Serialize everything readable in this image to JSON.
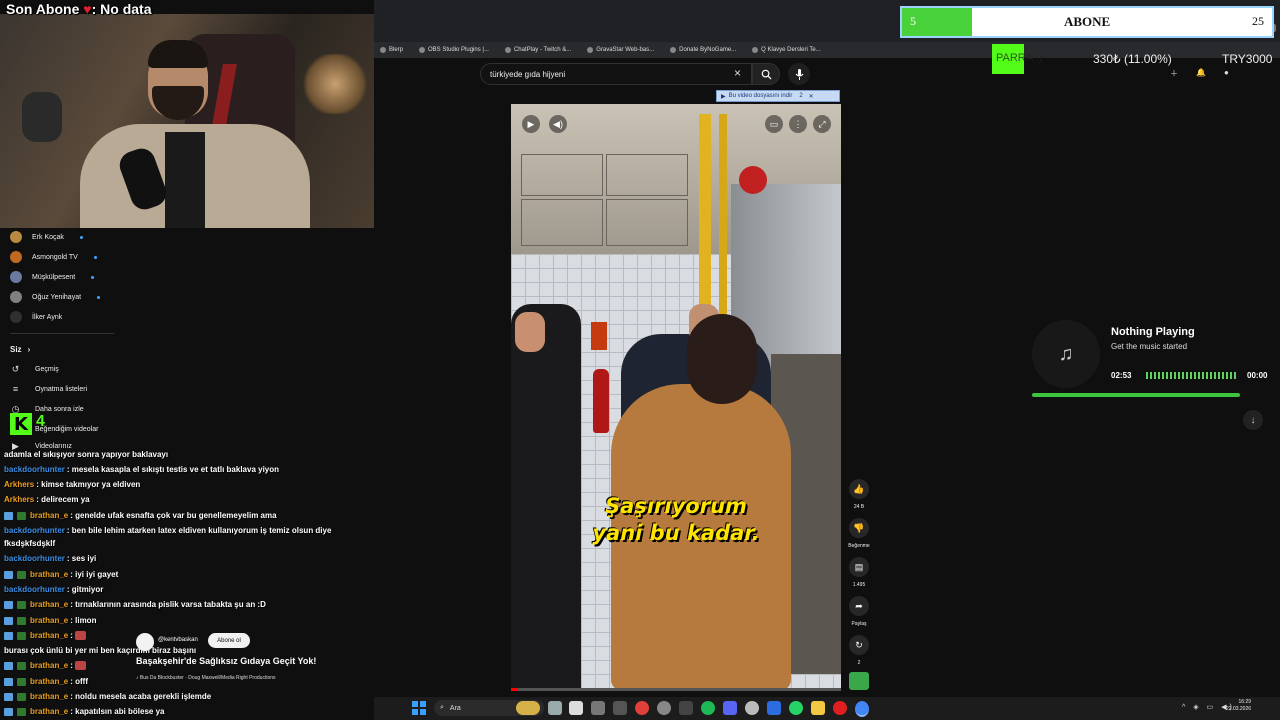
{
  "stream_overlay": {
    "title_left": "Son Abone",
    "title_right": "No data",
    "abone_current": "5",
    "abone_label": "ABONE",
    "abone_goal": "25",
    "abone_progress_fraction": 0.2,
    "para_label": "PARRA :)",
    "para_value": "330₺ (11.00%)",
    "para_goal": "TRY3000",
    "kick_letter": "K",
    "kick_count": "4"
  },
  "bookmarks": [
    {
      "label": "Blerp"
    },
    {
      "label": "OBS Studio Plugins |..."
    },
    {
      "label": "ChatPlay - Twitch &..."
    },
    {
      "label": "GravaStar Web-bas..."
    },
    {
      "label": "Donate ByNoGame..."
    },
    {
      "label": "Q Klavye Dersleri Te..."
    }
  ],
  "search": {
    "query": "türkiyede gıda hijyeni",
    "clear_icon": "×"
  },
  "download_banner": "Bu video dosyasını indir",
  "download_banner_count": "2",
  "sidebar": {
    "subscriptions": [
      {
        "name": "Erk Koçak"
      },
      {
        "name": "Asmongold TV"
      },
      {
        "name": "Müşkülpesent"
      },
      {
        "name": "Oğuz Yenihayat"
      },
      {
        "name": "İlker Aynk"
      }
    ],
    "you_header": "Siz",
    "you_items": [
      {
        "label": "Geçmiş"
      },
      {
        "label": "Oynatma listeleri"
      },
      {
        "label": "Daha sonra izle"
      },
      {
        "label": "Beğendiğim videolar"
      },
      {
        "label": "Videolarınız"
      }
    ]
  },
  "video": {
    "subtitle_line1": "Şaşırıyorum",
    "subtitle_line2": "yani bu kadar.",
    "progress_fraction": 0.02
  },
  "actions": {
    "likes": "24 B",
    "dislike_label": "Beğenme",
    "comments": "1.495",
    "share_label": "Paylaş",
    "remix_count": "2"
  },
  "short_overlay": {
    "channel": "@kentvbaskan",
    "subscribe_label": "Abone ol",
    "title": "Başakşehir'de Sağlıksız Gıdaya Geçit Yok!",
    "music": "Bus Da Blockbuster · Doug Maxwell/Media Right Productions"
  },
  "chat": [
    {
      "user": "",
      "user_color": "#ffffff",
      "text": "adamla el sıkışıyor sonra yapıyor baklavayı",
      "badge": "none"
    },
    {
      "user": "backdoorhunter",
      "user_color": "#3b8fe8",
      "text": ": mesela kasapla el sıkıştı testis ve et tatlı baklava yiyon",
      "badge": "none"
    },
    {
      "user": "Arkhers",
      "user_color": "#f0a020",
      "text": ": kimse takmıyor ya eldiven",
      "badge": "none"
    },
    {
      "user": "Arkhers",
      "user_color": "#f0a020",
      "text": ": delirecem ya",
      "badge": "none"
    },
    {
      "user": "brathan_e",
      "user_color": "#e8a020",
      "text": ": genelde ufak esnafta çok var bu genellemeyelim ama",
      "badge": "sub"
    },
    {
      "user": "backdoorhunter",
      "user_color": "#3b8fe8",
      "text": ": ben bile lehim atarken latex eldiven kullanıyorum iş temiz olsun diye",
      "badge": "none"
    },
    {
      "user": "",
      "user_color": "#ffffff",
      "text": "fksdşkfsdşklf",
      "badge": "none"
    },
    {
      "user": "backdoorhunter",
      "user_color": "#3b8fe8",
      "text": ": ses iyi",
      "badge": "none"
    },
    {
      "user": "brathan_e",
      "user_color": "#e8a020",
      "text": ": iyi iyi gayet",
      "badge": "sub"
    },
    {
      "user": "backdoorhunter",
      "user_color": "#3b8fe8",
      "text": ": gitmiyor",
      "badge": "none"
    },
    {
      "user": "brathan_e",
      "user_color": "#e8a020",
      "text": ": tırnaklarının arasında pislik varsa tabakta şu an :D",
      "badge": "sub"
    },
    {
      "user": "brathan_e",
      "user_color": "#e8a020",
      "text": ": limon",
      "badge": "sub"
    },
    {
      "user": "brathan_e",
      "user_color": "#e8a020",
      "text": ":",
      "badge": "sub"
    },
    {
      "user": "",
      "user_color": "#ffffff",
      "text": "burası çok ünlü bi yer mi ben kaçırdım biraz başını",
      "badge": "none"
    },
    {
      "user": "brathan_e",
      "user_color": "#e8a020",
      "text": ":",
      "badge": "sub"
    },
    {
      "user": "brathan_e",
      "user_color": "#e8a020",
      "text": ": offf",
      "badge": "sub"
    },
    {
      "user": "brathan_e",
      "user_color": "#e8a020",
      "text": ": noldu mesela acaba gerekli işlemde",
      "badge": "sub"
    },
    {
      "user": "brathan_e",
      "user_color": "#e8a020",
      "text": ": kapatılsın abi bölese ya",
      "badge": "sub"
    }
  ],
  "music_widget": {
    "title": "Nothing Playing",
    "subtitle": "Get the music started",
    "time_left": "02:53",
    "time_right": "00:00"
  },
  "taskbar": {
    "search_label": "Ara",
    "time": "16:29",
    "date": "22.03.2026"
  },
  "colors": {
    "kick_green": "#53fc18",
    "abone_green": "#49d23a",
    "subtitle_yellow": "#ffe400",
    "yt_red": "#ff0000"
  }
}
